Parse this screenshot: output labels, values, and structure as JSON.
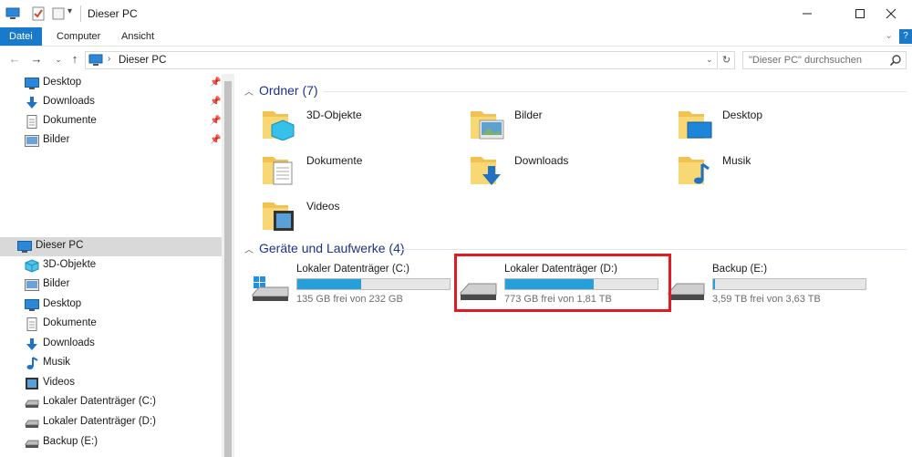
{
  "window": {
    "title": "Dieser PC",
    "minimize_icon": "minimize-icon",
    "maximize_icon": "maximize-icon",
    "close_icon": "close-icon"
  },
  "ribbon": {
    "tabs": [
      {
        "label": "Datei",
        "active": true
      },
      {
        "label": "Computer",
        "active": false
      },
      {
        "label": "Ansicht",
        "active": false
      }
    ]
  },
  "address": {
    "path": "Dieser PC",
    "search_placeholder": "\"Dieser PC\" durchsuchen"
  },
  "nav": {
    "quick_access": [
      {
        "label": "Desktop",
        "icon": "desktop-icon",
        "pinned": true
      },
      {
        "label": "Downloads",
        "icon": "downloads-icon",
        "pinned": true
      },
      {
        "label": "Dokumente",
        "icon": "documents-icon",
        "pinned": true
      },
      {
        "label": "Bilder",
        "icon": "pictures-icon",
        "pinned": true
      }
    ],
    "this_pc": {
      "label": "Dieser PC",
      "icon": "computer-icon",
      "selected": true
    },
    "this_pc_items": [
      {
        "label": "3D-Objekte",
        "icon": "3d-objects-icon"
      },
      {
        "label": "Bilder",
        "icon": "pictures-icon"
      },
      {
        "label": "Desktop",
        "icon": "desktop-icon"
      },
      {
        "label": "Dokumente",
        "icon": "documents-icon"
      },
      {
        "label": "Downloads",
        "icon": "downloads-icon"
      },
      {
        "label": "Musik",
        "icon": "music-icon"
      },
      {
        "label": "Videos",
        "icon": "videos-icon"
      },
      {
        "label": "Lokaler Datenträger (C:)",
        "icon": "drive-icon"
      },
      {
        "label": "Lokaler Datenträger (D:)",
        "icon": "drive-icon"
      },
      {
        "label": "Backup  (E:)",
        "icon": "drive-icon"
      }
    ]
  },
  "content": {
    "folders_header": "Ordner (7)",
    "folders": [
      {
        "label": "3D-Objekte",
        "icon": "3d-objects-folder-icon"
      },
      {
        "label": "Bilder",
        "icon": "pictures-folder-icon"
      },
      {
        "label": "Desktop",
        "icon": "desktop-folder-icon"
      },
      {
        "label": "Dokumente",
        "icon": "documents-folder-icon"
      },
      {
        "label": "Downloads",
        "icon": "downloads-folder-icon"
      },
      {
        "label": "Musik",
        "icon": "music-folder-icon"
      },
      {
        "label": "Videos",
        "icon": "videos-folder-icon"
      }
    ],
    "drives_header": "Geräte und Laufwerke (4)",
    "drives": [
      {
        "name": "Lokaler Datenträger (C:)",
        "free": "135 GB frei von 232 GB",
        "used_fraction": 0.42,
        "icon": "windows-drive-icon"
      },
      {
        "name": "Lokaler Datenträger (D:)",
        "free": "773 GB frei von 1,81 TB",
        "used_fraction": 0.58,
        "icon": "drive-icon"
      },
      {
        "name": "Backup  (E:)",
        "free": "3,59 TB frei von 3,63 TB",
        "used_fraction": 0.01,
        "icon": "drive-icon"
      }
    ]
  },
  "colors": {
    "accent": "#1979ca",
    "usage_bar": "#26a0da",
    "highlight": "#e11b22",
    "group_header": "#1e3287"
  }
}
